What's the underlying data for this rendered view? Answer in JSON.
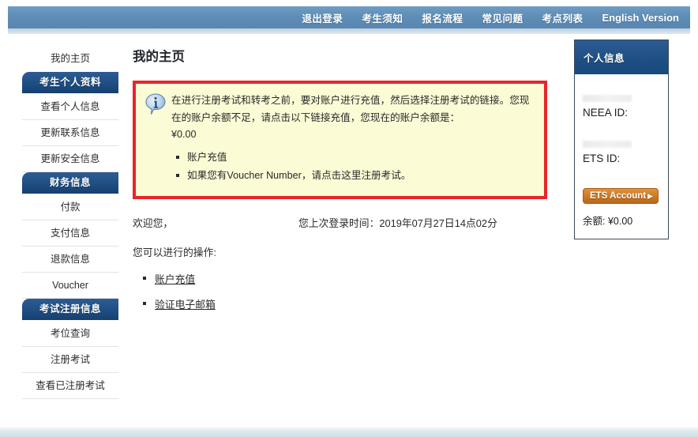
{
  "topnav": {
    "items": [
      {
        "label": "退出登录",
        "name": "nav-logout"
      },
      {
        "label": "考生须知",
        "name": "nav-notice"
      },
      {
        "label": "报名流程",
        "name": "nav-process"
      },
      {
        "label": "常见问题",
        "name": "nav-faq"
      },
      {
        "label": "考点列表",
        "name": "nav-test-centers"
      },
      {
        "label": "English Version",
        "name": "nav-english-version"
      }
    ]
  },
  "sidebar": {
    "items": [
      {
        "label": "我的主页",
        "type": "link"
      },
      {
        "label": "考生个人资料",
        "type": "header"
      },
      {
        "label": "查看个人信息",
        "type": "link"
      },
      {
        "label": "更新联系信息",
        "type": "link"
      },
      {
        "label": "更新安全信息",
        "type": "link"
      },
      {
        "label": "财务信息",
        "type": "header"
      },
      {
        "label": "付款",
        "type": "link"
      },
      {
        "label": "支付信息",
        "type": "link"
      },
      {
        "label": "退款信息",
        "type": "link"
      },
      {
        "label": "Voucher",
        "type": "link"
      },
      {
        "label": "考试注册信息",
        "type": "header"
      },
      {
        "label": "考位查询",
        "type": "link"
      },
      {
        "label": "注册考试",
        "type": "link"
      },
      {
        "label": "查看已注册考试",
        "type": "link"
      }
    ]
  },
  "main": {
    "page_title": "我的主页",
    "alert": {
      "text_part1": "在进行注册考试和转考之前，要对账户进行充值，然后选择注册考试的链接。您现在的账户余额不足，请点击以下链接充值，您现在的账户余额是：",
      "balance": "¥0.00",
      "items": [
        {
          "text": "账户充值",
          "link": "账户充值"
        },
        {
          "text": "如果您有Voucher Number，请点击这里注册考试。",
          "link": "这里"
        }
      ],
      "item2_prefix": "如果您有Voucher Number，请点击",
      "item2_link": "这里",
      "item2_suffix": "注册考试。"
    },
    "welcome": "欢迎您，",
    "last_login": "您上次登录时间：2019年07月27日14点02分",
    "actions_label": "您可以进行的操作:",
    "actions": [
      {
        "label": "账户充值"
      },
      {
        "label": "验证电子邮箱"
      }
    ]
  },
  "rightpanel": {
    "title": "个人信息",
    "neea_id_label": "NEEA ID:",
    "ets_id_label": "ETS ID:",
    "ets_account_button": "ETS Account",
    "balance": "余额: ¥0.00"
  },
  "colors": {
    "nav_blue": "#5e8db6",
    "panel_navy": "#1f4f85",
    "alert_border_red": "#e8252a",
    "alert_bg_yellow": "#fbfbd6",
    "ets_orange": "#cf7a24"
  }
}
